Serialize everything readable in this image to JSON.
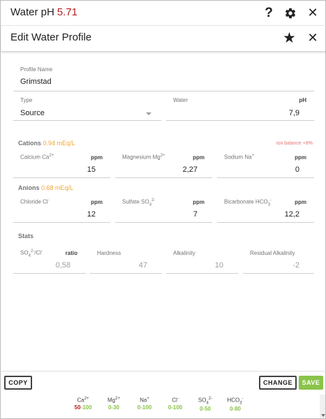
{
  "header": {
    "title": "Water pH",
    "ph_value": "5.71",
    "help_symbol": "?",
    "close_symbol": "✕"
  },
  "dialog": {
    "title": "Edit Water Profile",
    "favorite_symbol": "★",
    "close_symbol": "✕"
  },
  "profile": {
    "name_label": "Profile Name",
    "name_value": "Grimstad",
    "type_label": "Type",
    "type_value": "Source",
    "water_label": "Water",
    "ph_unit": "pH",
    "ph_value": "7,9"
  },
  "cations": {
    "title": "Cations",
    "meq": "0.94 mEq/L",
    "ion_balance": "ion balance +8%",
    "fields": [
      {
        "label": "Calcium Ca",
        "sup": "2+",
        "unit": "ppm",
        "value": "15"
      },
      {
        "label": "Magnesium Mg",
        "sup": "2+",
        "unit": "ppm",
        "value": "2,27"
      },
      {
        "label": "Sodium Na",
        "sup": "+",
        "unit": "ppm",
        "value": "0"
      }
    ]
  },
  "anions": {
    "title": "Anions",
    "meq": "0.68 mEq/L",
    "fields": [
      {
        "label": "Chloride Cl",
        "sup": "-",
        "unit": "ppm",
        "value": "12"
      },
      {
        "label": "Sulfate SO",
        "sub": "4",
        "sup": "2-",
        "unit": "ppm",
        "value": "7"
      },
      {
        "label": "Bicarbonate HCO",
        "sub": "3",
        "sup": "-",
        "unit": "ppm",
        "value": "12,2"
      }
    ]
  },
  "stats": {
    "title": "Stats",
    "ratio_label_a": "SO",
    "ratio_label_a_sub": "4",
    "ratio_label_a_sup": "2-",
    "ratio_label_b": "/Cl",
    "ratio_label_b_sup": "-",
    "ratio_unit": "ratio",
    "ratio_value": "0,58",
    "hardness_label": "Hardness",
    "hardness_value": "47",
    "alkalinity_label": "Alkalinity",
    "alkalinity_value": "10",
    "residual_label": "Residual Alkalinity",
    "residual_value": "-2"
  },
  "footer": {
    "copy_label": "COPY",
    "change_label": "CHANGE",
    "save_label": "SAVE",
    "ions": [
      {
        "name": "Ca",
        "sup": "2+",
        "range_low": "50",
        "range_rest": "-100"
      },
      {
        "name": "Mg",
        "sup": "2+",
        "range_low": "",
        "range_rest": "0-30"
      },
      {
        "name": "Na",
        "sup": "+",
        "range_low": "",
        "range_rest": "0-100"
      },
      {
        "name": "Cl",
        "sup": "-",
        "range_low": "",
        "range_rest": "0-100"
      },
      {
        "name": "SO",
        "sub": "4",
        "sup": "2-",
        "range_low": "",
        "range_rest": "0-50"
      },
      {
        "name": "HCO",
        "sub": "3",
        "sup": "-",
        "range_low": "",
        "range_rest": "0-80"
      }
    ]
  },
  "colors": {
    "ph_red": "#b71c1c",
    "meq_orange": "#f0a830",
    "save_green": "#8bc34a",
    "ion_balance_red": "#e57373"
  },
  "icons": {
    "help": "help-icon",
    "settings": "gear-icon",
    "close": "close-icon",
    "favorite": "star-icon",
    "dropdown": "chevron-down-icon"
  }
}
